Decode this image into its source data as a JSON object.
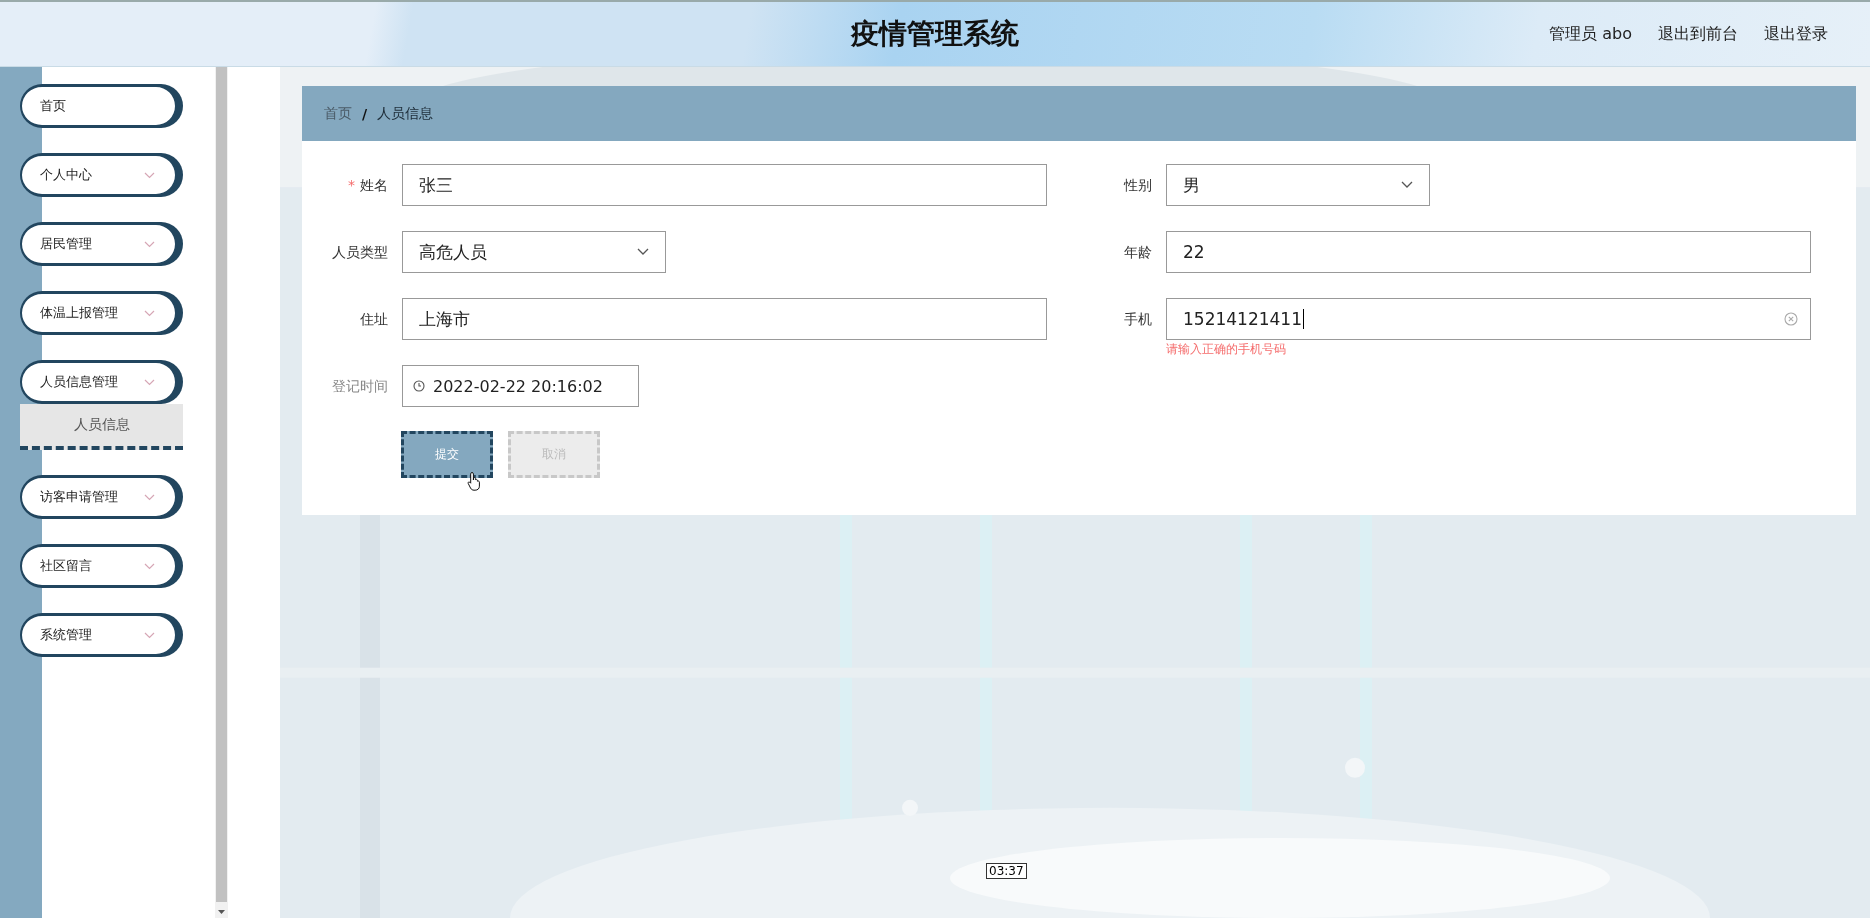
{
  "header": {
    "title": "疫情管理系统",
    "links": [
      "管理员 abo",
      "退出到前台",
      "退出登录"
    ]
  },
  "sidebar": {
    "items": [
      {
        "label": "首页",
        "kind": "link"
      },
      {
        "label": "个人中心",
        "kind": "menu"
      },
      {
        "label": "居民管理",
        "kind": "menu"
      },
      {
        "label": "体温上报管理",
        "kind": "menu"
      },
      {
        "label": "人员信息管理",
        "kind": "menu",
        "expanded": true,
        "children": [
          {
            "label": "人员信息",
            "selected": true
          }
        ]
      },
      {
        "label": "访客申请管理",
        "kind": "menu"
      },
      {
        "label": "社区留言",
        "kind": "menu"
      },
      {
        "label": "系统管理",
        "kind": "menu"
      }
    ]
  },
  "breadcrumb": {
    "items": [
      "首页",
      "人员信息"
    ],
    "separator": "/"
  },
  "form": {
    "rows": [
      {
        "left": {
          "label": "姓名",
          "required_mark": "*",
          "kind": "text",
          "value": "张三",
          "disabled": false
        },
        "right": {
          "label": "性别",
          "kind": "select",
          "value": "男",
          "disabled": false
        }
      },
      {
        "left": {
          "label": "人员类型",
          "kind": "select",
          "value": "高危人员",
          "disabled": false
        },
        "right": {
          "label": "年龄",
          "kind": "text",
          "value": "22",
          "disabled": false
        }
      },
      {
        "left": {
          "label": "住址",
          "kind": "text",
          "value": "上海市",
          "disabled": false
        },
        "right": {
          "label": "手机",
          "kind": "text",
          "value": "15214121411",
          "focused": true,
          "clearable": true,
          "error": "请输入正确的手机号码",
          "disabled": false
        }
      },
      {
        "left": {
          "label": "登记时间",
          "kind": "date",
          "value": "2022-02-22 20:16:02",
          "disabled": true
        }
      }
    ]
  },
  "buttons": [
    {
      "label": "提交",
      "kind": "primary",
      "hovered": true
    },
    {
      "label": "取消",
      "kind": "secondary"
    }
  ],
  "video_time": "03:37"
}
